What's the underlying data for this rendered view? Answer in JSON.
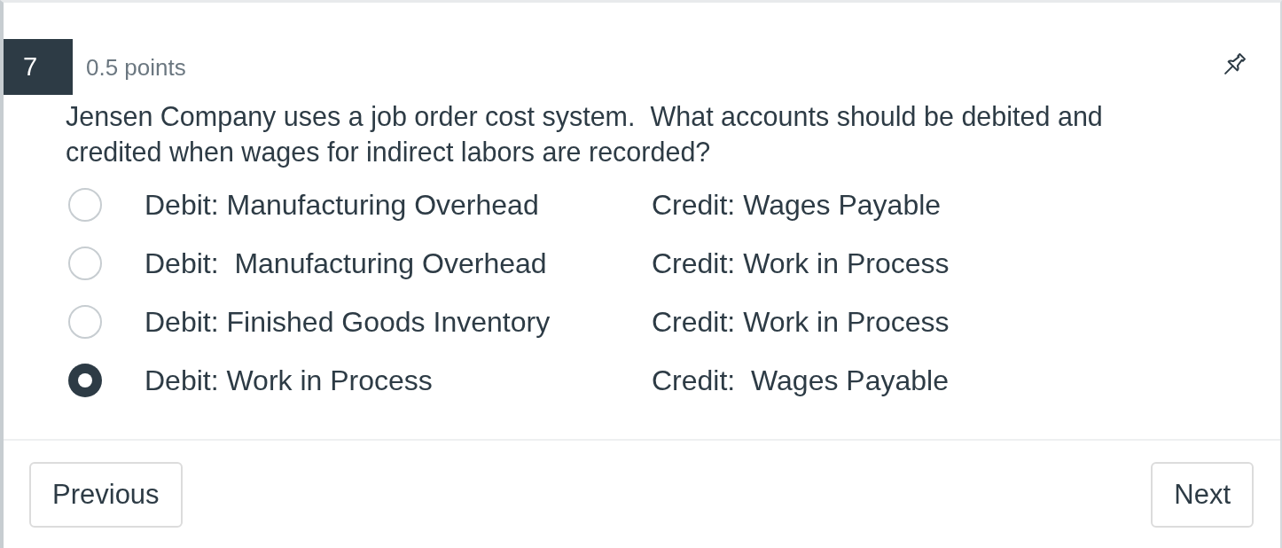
{
  "question": {
    "number": "7",
    "points": "0.5 points",
    "text": "Jensen Company uses a job order cost system.  What accounts should be debited and credited when wages for indirect labors are recorded?"
  },
  "options": [
    {
      "debit": "Debit: Manufacturing Overhead",
      "credit": "Credit: Wages Payable",
      "selected": false
    },
    {
      "debit": "Debit:  Manufacturing Overhead",
      "credit": "Credit: Work in Process",
      "selected": false
    },
    {
      "debit": "Debit: Finished Goods Inventory",
      "credit": "Credit: Work in Process",
      "selected": false
    },
    {
      "debit": "Debit: Work in Process",
      "credit": "Credit:  Wages Payable",
      "selected": true
    }
  ],
  "footer": {
    "previous": "Previous",
    "next": "Next"
  }
}
